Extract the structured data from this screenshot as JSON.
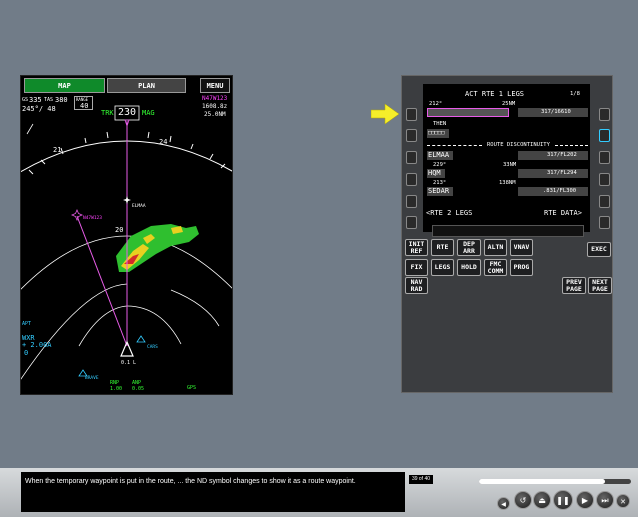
{
  "nd": {
    "tabs": {
      "map": "MAP",
      "plan": "PLAN",
      "menu": "MENU"
    },
    "gs_label": "GS",
    "gs": "335",
    "tas_label": "TAS",
    "tas": "380",
    "wind": "245°/ 48",
    "range_label": "RANGE",
    "range": "40",
    "trk_label": "TRK",
    "heading": "230",
    "mag_label": "MAG",
    "active_wpt": "N47W123",
    "eta": "1608.8z",
    "dist": "25.0NM",
    "compass_21": "21",
    "compass_24": "24",
    "range_mark": "20",
    "wpt_temp": "N47W123",
    "wpt_elmaa": "ELMAA",
    "wpt_cars": "CARS",
    "wpt_brave": "BRAVE",
    "apt": "APT",
    "wxr_label": "WXR",
    "wxr_val": "+ 2.00A",
    "wxr_zero": "0",
    "vor_l": "0.1 L",
    "rnp_label": "RNP",
    "rnp_val": "1.00",
    "anp_label": "ANP",
    "anp_val": "0.05",
    "gps_label": "GPS"
  },
  "cdu": {
    "title": "ACT RTE 1 LEGS",
    "page": "1/8",
    "rows": [
      {
        "small_left": "212°",
        "small_right": "25NM",
        "left": "",
        "right": "317/16610"
      },
      {
        "small_left": "THEN",
        "small_right": "",
        "left": "□□□□□",
        "right": ""
      },
      {
        "small_left": "",
        "small_right": "",
        "left": "ELMAA",
        "right": "317/FL202"
      },
      {
        "small_left": "229°",
        "small_right": "33NM",
        "left": "HQM",
        "right": "317/FL294"
      },
      {
        "small_left": "213°",
        "small_right": "138NM",
        "left": "SEDAR",
        "right": ".831/FL300"
      }
    ],
    "discontinuity": "ROUTE DISCONTINUITY",
    "rte2": "<RTE 2 LEGS",
    "rte_data": "RTE DATA>",
    "keys": {
      "init_ref": "INIT\nREF",
      "rte": "RTE",
      "dep_arr": "DEP\nARR",
      "altn": "ALTN",
      "vnav": "VNAV",
      "exec": "EXEC",
      "fix": "FIX",
      "legs": "LEGS",
      "hold": "HOLD",
      "fmc_comm": "FMC\nCOMM",
      "prog": "PROG",
      "nav_rad": "NAV\nRAD",
      "prev_page": "PREV\nPAGE",
      "next_page": "NEXT\nPAGE"
    }
  },
  "player": {
    "caption": "When the temporary waypoint is put in the route, ... the ND symbol changes to show it as a route waypoint.",
    "page_count": "39 of 40",
    "progress": 0.83
  },
  "colors": {
    "arrow": "#f5ee2a",
    "route": "#e85ce8",
    "green": "#33ff33"
  }
}
